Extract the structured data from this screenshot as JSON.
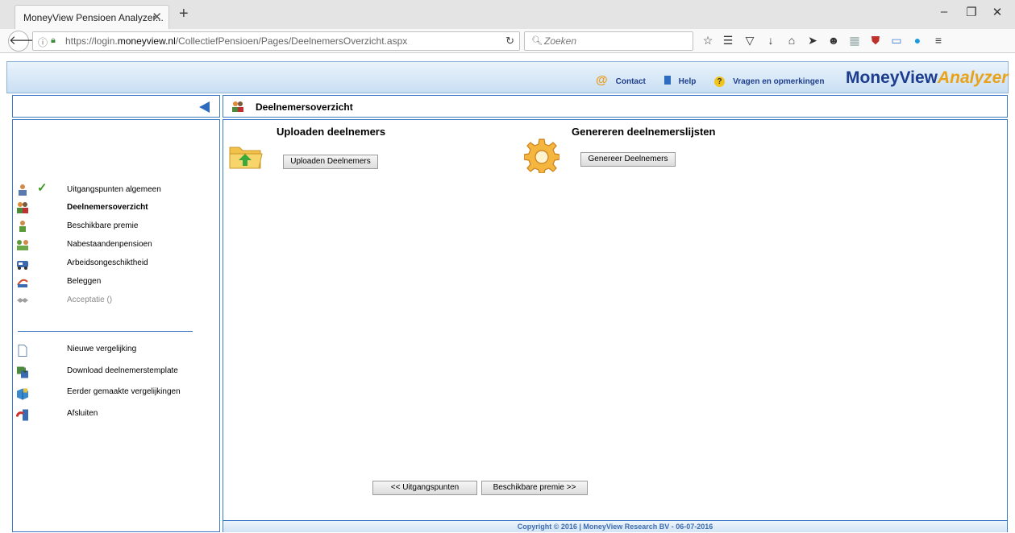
{
  "browser": {
    "tab_title": "MoneyView Pensioen Analyzer...",
    "url_prefix": "https://login.",
    "url_domain": "moneyview.nl",
    "url_path": "/CollectiefPensioen/Pages/DeelnemersOverzicht.aspx",
    "search_placeholder": "Zoeken"
  },
  "header": {
    "contact": "Contact",
    "help": "Help",
    "feedback": "Vragen en opmerkingen",
    "logo_main": "MoneyView",
    "logo_accent": "Analyzer"
  },
  "page_title": "Deelnemersoverzicht",
  "sidebar": {
    "steps": [
      {
        "label": "Uitgangspunten algemeen",
        "done": true
      },
      {
        "label": "Deelnemersoverzicht",
        "active": true
      },
      {
        "label": "Beschikbare premie"
      },
      {
        "label": "Nabestaandenpensioen"
      },
      {
        "label": "Arbeidsongeschiktheid"
      },
      {
        "label": "Beleggen"
      },
      {
        "label": "Acceptatie ()",
        "disabled": true
      }
    ],
    "actions": [
      {
        "label": "Nieuwe vergelijking"
      },
      {
        "label": "Download deelnemerstemplate"
      },
      {
        "label": "Eerder gemaakte vergelijkingen"
      },
      {
        "label": "Afsluiten"
      }
    ]
  },
  "main": {
    "upload_title": "Uploaden deelnemers",
    "upload_button": "Uploaden Deelnemers",
    "generate_title": "Genereren deelnemerslijsten",
    "generate_button": "Genereer Deelnemers",
    "prev_button": "<< Uitgangspunten",
    "next_button": "Beschikbare premie >>"
  },
  "footer": "Copyright © 2016 | MoneyView Research BV - 06-07-2016",
  "colors": {
    "accent_blue": "#3d7bc4",
    "logo_blue": "#1c3c8e",
    "logo_orange": "#e8a21c"
  }
}
